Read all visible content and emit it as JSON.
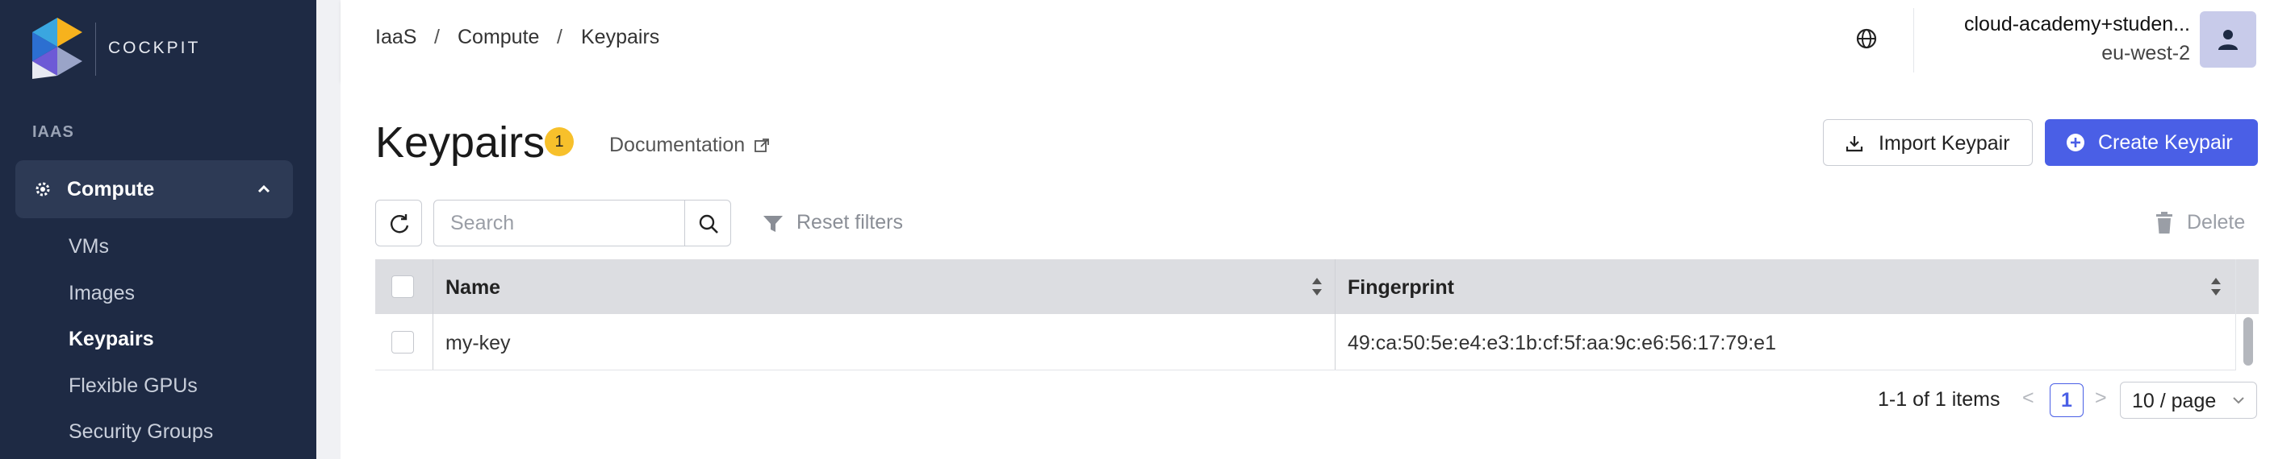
{
  "sidebar": {
    "brand": "COCKPIT",
    "section_label": "IAAS",
    "group": {
      "label": "Compute",
      "icon": "cog-icon",
      "expanded": true
    },
    "items": [
      {
        "label": "VMs",
        "active": false
      },
      {
        "label": "Images",
        "active": false
      },
      {
        "label": "Keypairs",
        "active": true
      },
      {
        "label": "Flexible GPUs",
        "active": false
      },
      {
        "label": "Security Groups",
        "active": false
      }
    ]
  },
  "header": {
    "breadcrumb": [
      "IaaS",
      "Compute",
      "Keypairs"
    ],
    "separator": "/",
    "account_name": "cloud-academy+studen...",
    "region": "eu-west-2"
  },
  "page": {
    "title": "Keypairs",
    "count": "1",
    "documentation_label": "Documentation",
    "import_label": "Import Keypair",
    "create_label": "Create Keypair"
  },
  "toolbar": {
    "search_placeholder": "Search",
    "reset_filters_label": "Reset filters",
    "delete_label": "Delete"
  },
  "table": {
    "columns": [
      "Name",
      "Fingerprint"
    ],
    "rows": [
      {
        "name": "my-key",
        "fingerprint": "49:ca:50:5e:e4:e3:1b:cf:5f:aa:9c:e6:56:17:79:e1"
      }
    ]
  },
  "pagination": {
    "summary": "1-1 of 1 items",
    "prev": "<",
    "current_page": "1",
    "next": ">",
    "page_size": "10 / page"
  },
  "colors": {
    "sidebar_bg": "#1e2a44",
    "accent": "#4a5fe6",
    "badge": "#f7c02b",
    "avatar_bg": "#c8cbea"
  }
}
